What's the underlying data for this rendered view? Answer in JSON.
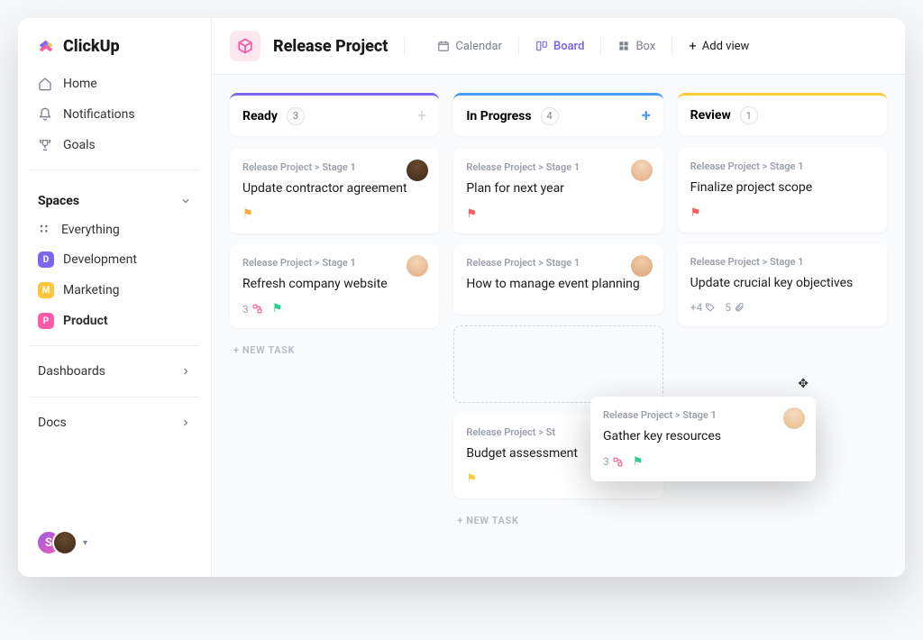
{
  "brand": {
    "name": "ClickUp"
  },
  "nav": {
    "home": "Home",
    "notifications": "Notifications",
    "goals": "Goals"
  },
  "spaces": {
    "header": "Spaces",
    "everything": "Everything",
    "items": [
      {
        "label": "Development",
        "initial": "D",
        "color": "#7b68ee"
      },
      {
        "label": "Marketing",
        "initial": "M",
        "color": "#ffc53d"
      },
      {
        "label": "Product",
        "initial": "P",
        "color": "#fd5ba5",
        "active": true
      }
    ]
  },
  "nav2": {
    "dashboards": "Dashboards",
    "docs": "Docs"
  },
  "project": {
    "title": "Release Project"
  },
  "views": {
    "calendar": "Calendar",
    "board": "Board",
    "box": "Box",
    "add": "Add view"
  },
  "columns": [
    {
      "title": "Ready",
      "count": "3",
      "color": "#7b68ee",
      "plusStyle": "gray"
    },
    {
      "title": "In Progress",
      "count": "4",
      "color": "#4a9eff",
      "plusStyle": "blue"
    },
    {
      "title": "Review",
      "count": "1",
      "color": "#ffcb3c",
      "plusStyle": "none"
    }
  ],
  "cards": {
    "ready": [
      {
        "crumb": "Release Project > Stage 1",
        "title": "Update contractor agreement",
        "flag": "orange",
        "avatar": "face1"
      },
      {
        "crumb": "Release Project > Stage 1",
        "title": "Refresh company website",
        "subCount": "3",
        "flag": "teal",
        "avatar": "face2"
      }
    ],
    "inprogress": [
      {
        "crumb": "Release Project > Stage 1",
        "title": "Plan for next year",
        "flag": "red",
        "avatar": "face2"
      },
      {
        "crumb": "Release Project > Stage 1",
        "title": "How to manage event planning",
        "avatar": "face3"
      },
      {
        "crumb": "Release Project > St",
        "title": "Budget assessment",
        "flag": "yellow"
      }
    ],
    "review": [
      {
        "crumb": "Release Project > Stage 1",
        "title": "Finalize project scope",
        "flag": "red"
      },
      {
        "crumb": "Release Project > Stage 1",
        "title": "Update crucial key objectives",
        "tags": "+4",
        "attachments": "5"
      }
    ],
    "dragging": {
      "crumb": "Release Project > Stage 1",
      "title": "Gather key resources",
      "subCount": "3",
      "flag": "teal",
      "avatar": "face4"
    }
  },
  "labels": {
    "newTask": "+ NEW TASK"
  },
  "avatars": {
    "initial": "S"
  }
}
